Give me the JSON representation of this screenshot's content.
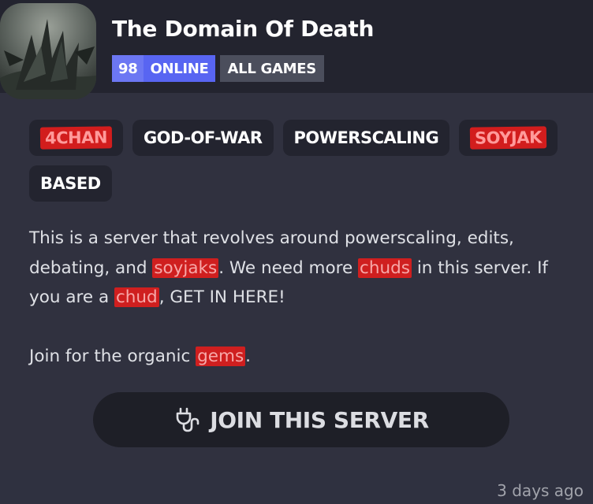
{
  "server": {
    "name": "The Domain Of Death",
    "online_count": "98",
    "online_label": "ONLINE",
    "games_label": "ALL GAMES"
  },
  "tags": [
    {
      "label": "4CHAN",
      "redacted": true
    },
    {
      "label": "GOD-OF-WAR",
      "redacted": false
    },
    {
      "label": "POWERSCALING",
      "redacted": false
    },
    {
      "label": "SOYJAK",
      "redacted": true
    },
    {
      "label": "BASED",
      "redacted": false
    }
  ],
  "description": {
    "p1_a": "This is a server that revolves around powerscaling, edits, debating, and ",
    "p1_r1": "soyjaks",
    "p1_b": ". We need more ",
    "p1_r2": "chuds",
    "p1_c": " in this server. If you are a ",
    "p1_r3": "chud",
    "p1_d": ", GET IN HERE!",
    "p2_a": "Join for the organic ",
    "p2_r1": "gems",
    "p2_b": "."
  },
  "join_button": {
    "label": "JOIN THIS SERVER",
    "icon": "plug-icon"
  },
  "timestamp": "3 days ago",
  "colors": {
    "accent": "#5865f2",
    "redaction": "#d21d1d",
    "card_bg": "#30313f",
    "header_bg": "#23242f"
  }
}
